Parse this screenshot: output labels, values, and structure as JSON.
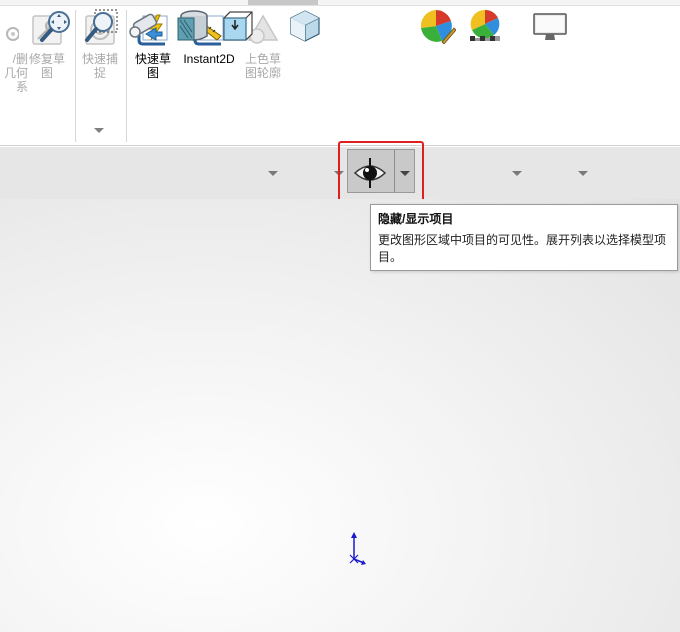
{
  "ribbon": {
    "buttons": [
      {
        "id": "partial-add-relations",
        "label": "/删\n几何\n系",
        "state": "disabled"
      },
      {
        "id": "repair-sketch",
        "label": "修复草\n图",
        "state": "disabled"
      },
      {
        "id": "quick-snaps",
        "label": "快速捕\n捉",
        "state": "disabled"
      },
      {
        "id": "rapid-sketch",
        "label": "快速草\n图",
        "state": "enabled"
      },
      {
        "id": "instant2d",
        "label": "Instant2D",
        "state": "enabled"
      },
      {
        "id": "shaded-sketch-contours",
        "label": "上色草\n图轮廓",
        "state": "disabled"
      }
    ]
  },
  "hud_toolbar": {
    "items": [
      {
        "name": "zoom-to-fit",
        "has_dropdown": false
      },
      {
        "name": "zoom-to-area",
        "has_dropdown": false
      },
      {
        "name": "previous-view",
        "has_dropdown": false
      },
      {
        "name": "section-view",
        "has_dropdown": false
      },
      {
        "name": "view-orientation",
        "has_dropdown": true
      },
      {
        "name": "display-style",
        "has_dropdown": true
      },
      {
        "name": "hide-show-items",
        "has_dropdown": true,
        "highlighted": true
      },
      {
        "name": "edit-appearance",
        "has_dropdown": false
      },
      {
        "name": "apply-scene",
        "has_dropdown": true
      },
      {
        "name": "view-settings",
        "has_dropdown": true
      }
    ]
  },
  "tooltip": {
    "title": "隐藏/显示项目",
    "body": "更改图形区域中项目的可见性。展开列表以选择模型项目。"
  },
  "colors": {
    "highlight_border": "#e02020",
    "triad_axis": "#1a1acc",
    "toolbar_bg": "#e6e6e6"
  }
}
